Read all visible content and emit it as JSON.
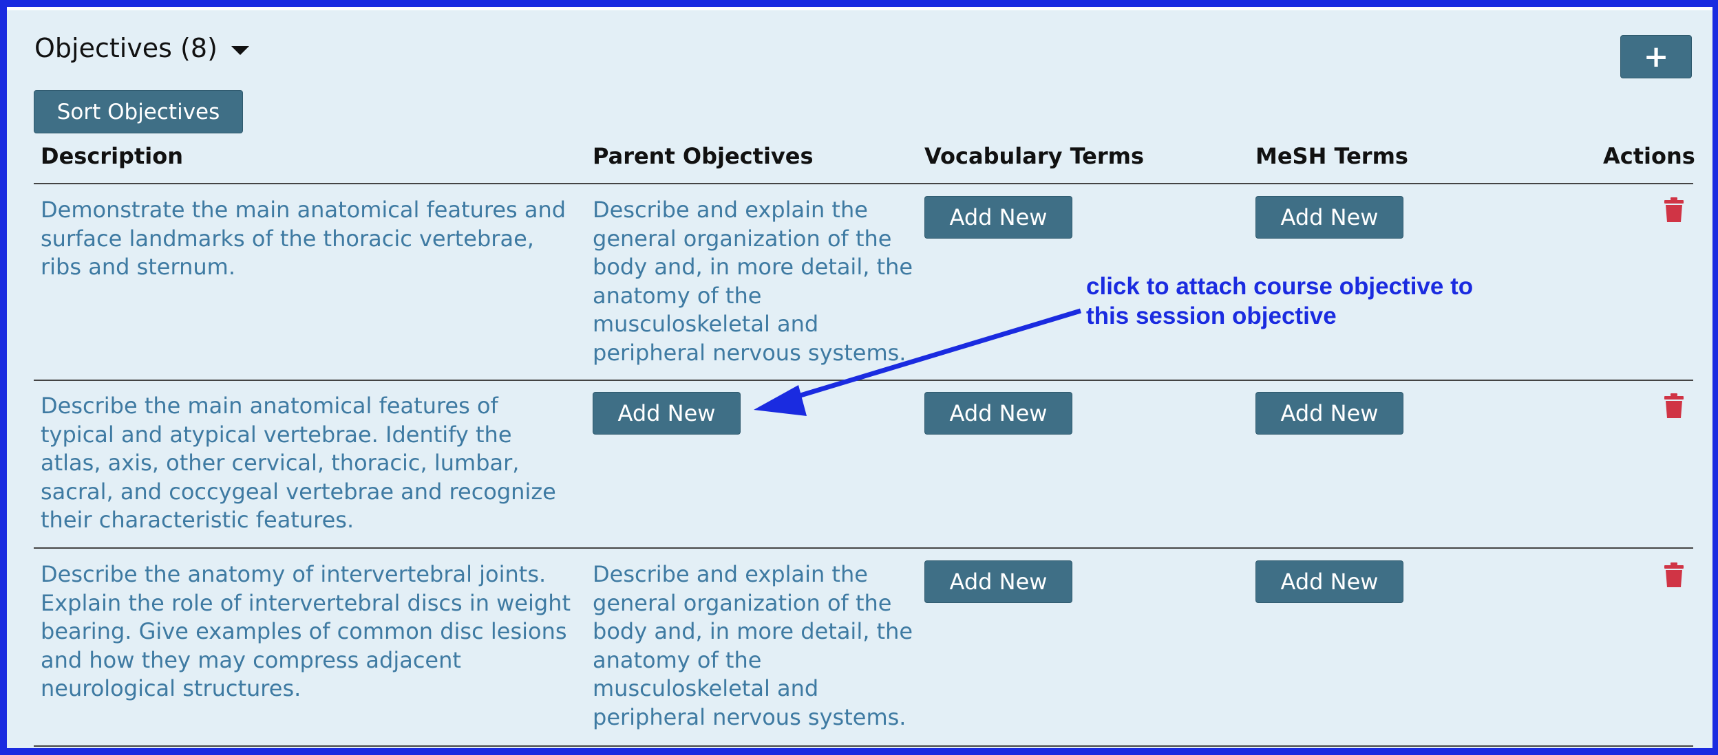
{
  "section": {
    "title": "Objectives (8)"
  },
  "toolbar": {
    "sort_label": "Sort Objectives",
    "add_label": "+"
  },
  "columns": [
    "Description",
    "Parent Objectives",
    "Vocabulary Terms",
    "MeSH Terms",
    "Actions"
  ],
  "rows": [
    {
      "description": "Demonstrate the main anatomical features and surface landmarks of the thoracic vertebrae, ribs and sternum.",
      "parent": "Describe and explain the general organization of the body and, in more detail, the anatomy of the musculoskeletal and peripheral nervous systems.",
      "vocab_button": "Add New",
      "mesh_button": "Add New"
    },
    {
      "description": "Describe the main anatomical features of typical and atypical vertebrae. Identify the atlas, axis, other cervical, thoracic, lumbar, sacral, and coccygeal vertebrae and recognize their characteristic features.",
      "parent_button": "Add New",
      "vocab_button": "Add New",
      "mesh_button": "Add New"
    },
    {
      "description": "Describe the anatomy of intervertebral joints. Explain the role of intervertebral discs in weight bearing. Give examples of common disc lesions and how they may compress adjacent neurological structures.",
      "parent": "Describe and explain the general organization of the body and, in more detail, the anatomy of the musculoskeletal and peripheral nervous systems.",
      "vocab_button": "Add New",
      "mesh_button": "Add New"
    }
  ],
  "annotation": {
    "line1": "click to attach course objective to",
    "line2": "this session objective"
  },
  "colors": {
    "accent_border": "#1a2be0",
    "button": "#3f6f86",
    "link_text": "#3e7aa2",
    "delete_icon": "#d03445",
    "panel_bg": "#e3eff6"
  }
}
